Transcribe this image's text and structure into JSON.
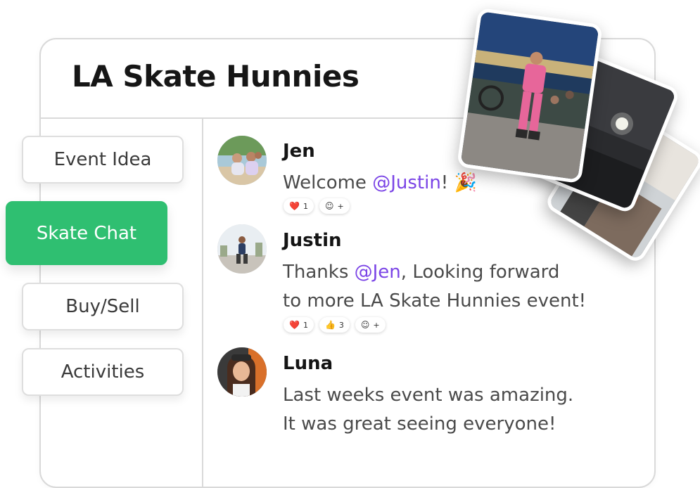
{
  "app": {
    "title": "LA Skate Hunnies"
  },
  "sidebar": {
    "items": [
      {
        "label": "Event Idea",
        "active": false
      },
      {
        "label": "Skate Chat",
        "active": true
      },
      {
        "label": "Buy/Sell",
        "active": false
      },
      {
        "label": "Activities",
        "active": false
      }
    ]
  },
  "messages": [
    {
      "author": "Jen",
      "lines": [
        {
          "before": "Welcome ",
          "mention": "@Justin",
          "after": "! 🎉"
        }
      ],
      "reactions": [
        {
          "emoji": "❤️",
          "count": "1"
        },
        {
          "emoji": "☺",
          "count": "+"
        }
      ]
    },
    {
      "author": "Justin",
      "lines": [
        {
          "before": "Thanks ",
          "mention": "@Jen",
          "after": ", Looking forward"
        },
        {
          "text": "to more LA Skate Hunnies event!"
        }
      ],
      "reactions": [
        {
          "emoji": "❤️",
          "count": "1"
        },
        {
          "emoji": "👍",
          "count": "3"
        },
        {
          "emoji": "☺",
          "count": "+"
        }
      ]
    },
    {
      "author": "Luna",
      "lines": [
        {
          "text": "Last weeks event was amazing."
        },
        {
          "text": "It was great seeing everyone!"
        }
      ],
      "reactions": []
    }
  ],
  "colors": {
    "accent_green": "#2fbf71",
    "mention_purple": "#7b45e6"
  }
}
